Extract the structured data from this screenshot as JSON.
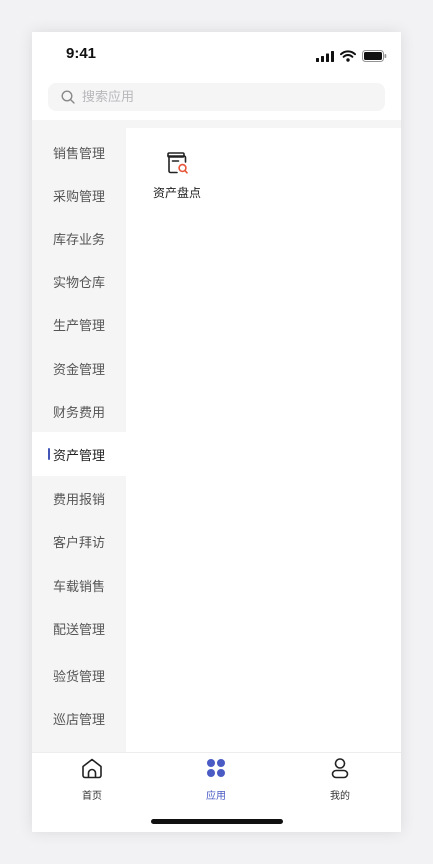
{
  "status_bar": {
    "time": "9:41",
    "icons": [
      "signal-icon",
      "wifi-icon",
      "battery-icon"
    ]
  },
  "search": {
    "placeholder": "搜索应用",
    "value": "",
    "icon": "search-icon"
  },
  "sidebar": {
    "active_index": 7,
    "accent_color": "#4455b8",
    "items": [
      {
        "label": "销售管理"
      },
      {
        "label": "采购管理"
      },
      {
        "label": "库存业务"
      },
      {
        "label": "实物仓库"
      },
      {
        "label": "生产管理"
      },
      {
        "label": "资金管理"
      },
      {
        "label": "财务费用"
      },
      {
        "label": "资产管理"
      },
      {
        "label": "费用报销"
      },
      {
        "label": "客户拜访"
      },
      {
        "label": "车载销售"
      },
      {
        "label": "配送管理"
      },
      {
        "label": "验货管理"
      },
      {
        "label": "巡店管理"
      }
    ]
  },
  "content": {
    "apps": [
      {
        "label": "资产盘点",
        "icon": "asset-inventory-icon",
        "icon_accent": "#e8563a"
      }
    ]
  },
  "tab_bar": {
    "active_color": "#4a5bc4",
    "tabs": [
      {
        "label": "首页",
        "icon": "home-icon"
      },
      {
        "label": "应用",
        "icon": "apps-grid-icon",
        "active": true
      },
      {
        "label": "我的",
        "icon": "user-icon"
      }
    ]
  }
}
